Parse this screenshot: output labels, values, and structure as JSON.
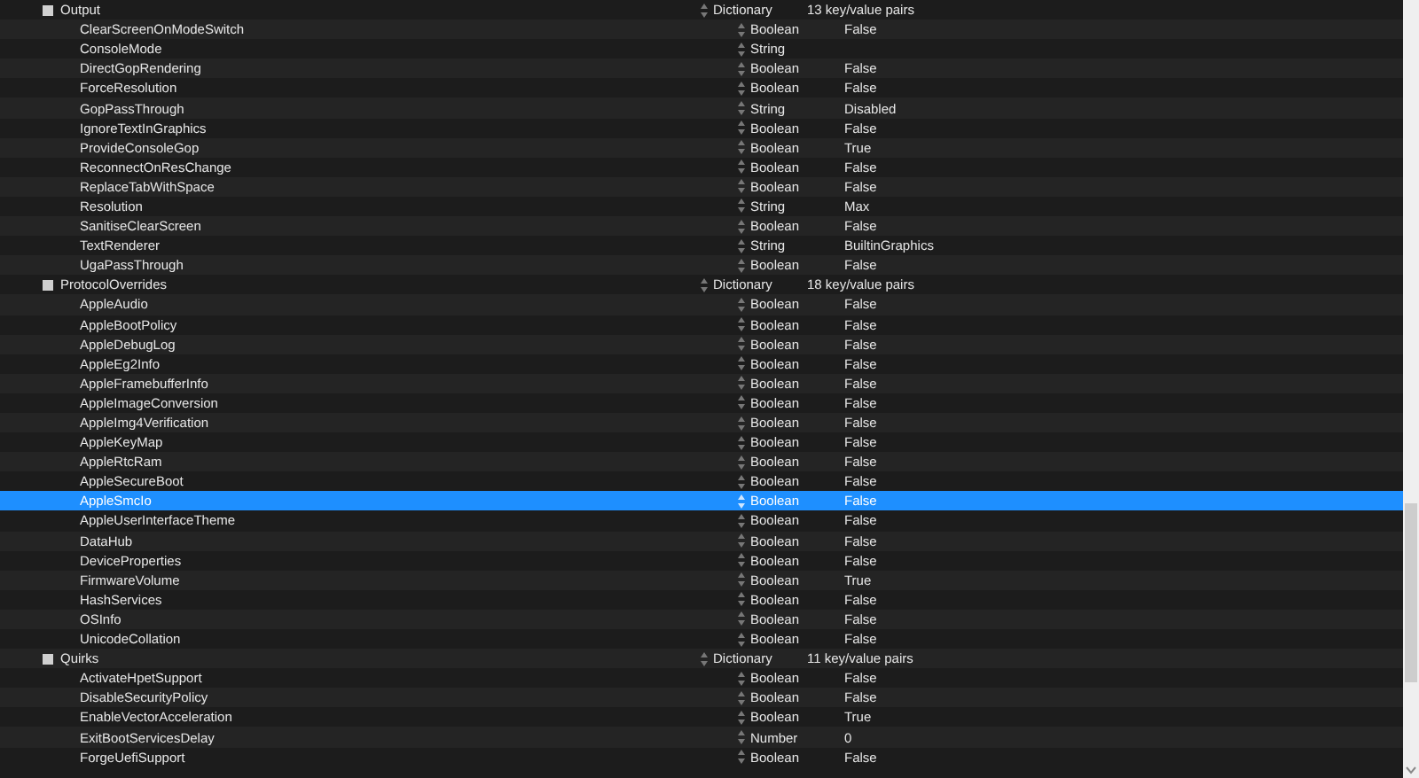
{
  "groups": [
    {
      "key": "Output",
      "type": "Dictionary",
      "value": "13 key/value pairs",
      "selected": false,
      "children": [
        {
          "key": "ClearScreenOnModeSwitch",
          "type": "Boolean",
          "value": "False",
          "selected": false
        },
        {
          "key": "ConsoleMode",
          "type": "String",
          "selected": false
        },
        {
          "key": "DirectGopRendering",
          "type": "Boolean",
          "value": "False",
          "selected": false
        },
        {
          "key": "ForceResolution",
          "type": "Boolean",
          "value": "False",
          "selected": false
        },
        {
          "key": "GopPassThrough",
          "type": "String",
          "value": "Disabled",
          "selected": false
        },
        {
          "key": "IgnoreTextInGraphics",
          "type": "Boolean",
          "value": "False",
          "selected": false
        },
        {
          "key": "ProvideConsoleGop",
          "type": "Boolean",
          "value": "True",
          "selected": false
        },
        {
          "key": "ReconnectOnResChange",
          "type": "Boolean",
          "value": "False",
          "selected": false
        },
        {
          "key": "ReplaceTabWithSpace",
          "type": "Boolean",
          "value": "False",
          "selected": false
        },
        {
          "key": "Resolution",
          "type": "String",
          "value": "Max",
          "selected": false
        },
        {
          "key": "SanitiseClearScreen",
          "type": "Boolean",
          "value": "False",
          "selected": false
        },
        {
          "key": "TextRenderer",
          "type": "String",
          "value": "BuiltinGraphics",
          "selected": false
        },
        {
          "key": "UgaPassThrough",
          "type": "Boolean",
          "value": "False",
          "selected": false
        }
      ]
    },
    {
      "key": "ProtocolOverrides",
      "type": "Dictionary",
      "value": "18 key/value pairs",
      "selected": false,
      "children": [
        {
          "key": "AppleAudio",
          "type": "Boolean",
          "value": "False",
          "selected": false
        },
        {
          "key": "AppleBootPolicy",
          "type": "Boolean",
          "value": "False",
          "selected": false
        },
        {
          "key": "AppleDebugLog",
          "type": "Boolean",
          "value": "False",
          "selected": false
        },
        {
          "key": "AppleEg2Info",
          "type": "Boolean",
          "value": "False",
          "selected": false
        },
        {
          "key": "AppleFramebufferInfo",
          "type": "Boolean",
          "value": "False",
          "selected": false
        },
        {
          "key": "AppleImageConversion",
          "type": "Boolean",
          "value": "False",
          "selected": false
        },
        {
          "key": "AppleImg4Verification",
          "type": "Boolean",
          "value": "False",
          "selected": false
        },
        {
          "key": "AppleKeyMap",
          "type": "Boolean",
          "value": "False",
          "selected": false
        },
        {
          "key": "AppleRtcRam",
          "type": "Boolean",
          "value": "False",
          "selected": false
        },
        {
          "key": "AppleSecureBoot",
          "type": "Boolean",
          "value": "False",
          "selected": false
        },
        {
          "key": "AppleSmcIo",
          "type": "Boolean",
          "value": "False",
          "selected": true
        },
        {
          "key": "AppleUserInterfaceTheme",
          "type": "Boolean",
          "value": "False",
          "selected": false
        },
        {
          "key": "DataHub",
          "type": "Boolean",
          "value": "False",
          "selected": false
        },
        {
          "key": "DeviceProperties",
          "type": "Boolean",
          "value": "False",
          "selected": false
        },
        {
          "key": "FirmwareVolume",
          "type": "Boolean",
          "value": "True",
          "selected": false
        },
        {
          "key": "HashServices",
          "type": "Boolean",
          "value": "False",
          "selected": false
        },
        {
          "key": "OSInfo",
          "type": "Boolean",
          "value": "False",
          "selected": false
        },
        {
          "key": "UnicodeCollation",
          "type": "Boolean",
          "value": "False",
          "selected": false
        }
      ]
    },
    {
      "key": "Quirks",
      "type": "Dictionary",
      "value": "11 key/value pairs",
      "selected": false,
      "children": [
        {
          "key": "ActivateHpetSupport",
          "type": "Boolean",
          "value": "False",
          "selected": false
        },
        {
          "key": "DisableSecurityPolicy",
          "type": "Boolean",
          "value": "False",
          "selected": false
        },
        {
          "key": "EnableVectorAcceleration",
          "type": "Boolean",
          "value": "True",
          "selected": false
        },
        {
          "key": "ExitBootServicesDelay",
          "type": "Number",
          "value": "0",
          "selected": false
        },
        {
          "key": "ForgeUefiSupport",
          "type": "Boolean",
          "value": "False",
          "selected": false
        }
      ]
    }
  ]
}
